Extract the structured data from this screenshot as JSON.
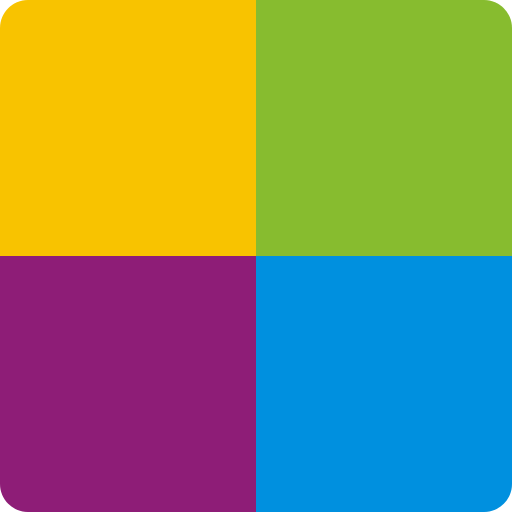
{
  "icon": {
    "name": "four-color-grid-icon",
    "quadrants": [
      {
        "position": "top-left",
        "color": "#F8C300"
      },
      {
        "position": "top-right",
        "color": "#87BC2F"
      },
      {
        "position": "bottom-left",
        "color": "#8E1D77"
      },
      {
        "position": "bottom-right",
        "color": "#0090DF"
      }
    ]
  }
}
